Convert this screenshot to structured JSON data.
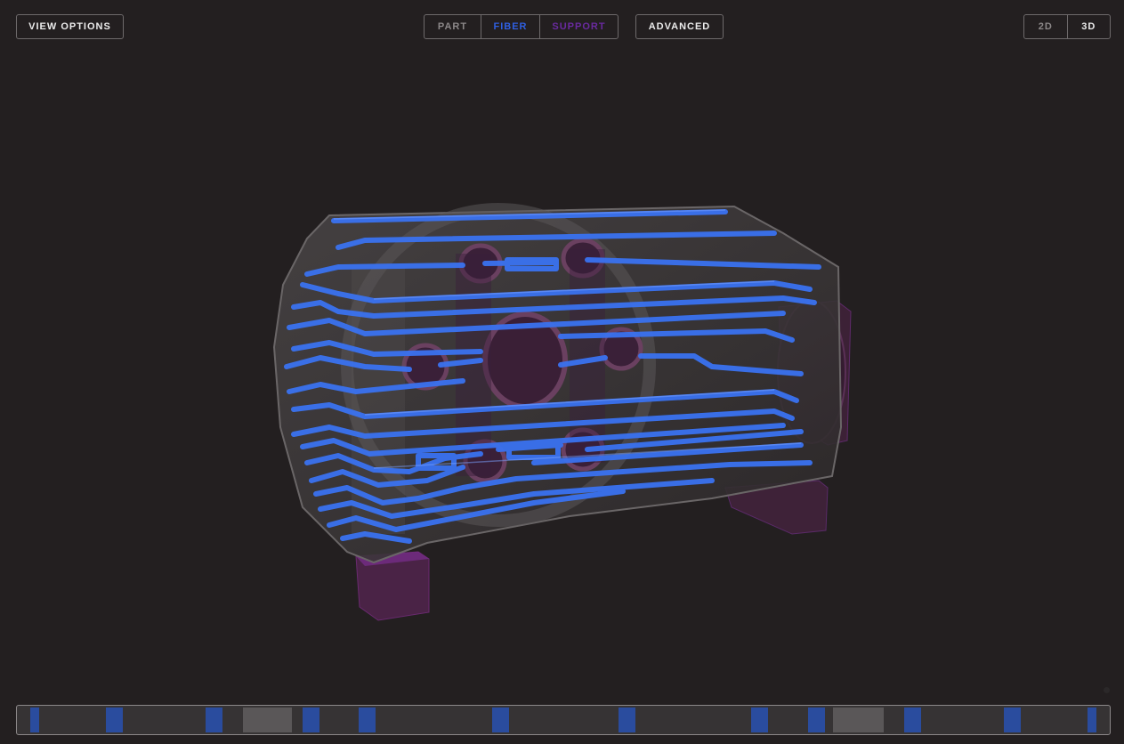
{
  "toolbar": {
    "view_options_label": "VIEW OPTIONS",
    "mode_tabs": {
      "part": "PART",
      "fiber": "FIBER",
      "support": "SUPPORT"
    },
    "advanced_label": "ADVANCED",
    "dimension_tabs": {
      "two_d": "2D",
      "three_d": "3D"
    },
    "selected_dimension": "3D"
  },
  "colors": {
    "background": "#231f20",
    "fiber": "#2f5fe0",
    "support": "#6a2aa0",
    "part": "#8c8889"
  },
  "viewport": {
    "model_icon": "3d-part-model-icon"
  },
  "layer_timeline": {
    "marker_types": [
      "fiber",
      "fiber",
      "fiber",
      "part",
      "fiber",
      "fiber",
      "fiber",
      "fiber",
      "fiber",
      "fiber",
      "part",
      "fiber",
      "fiber",
      "fiber"
    ]
  }
}
